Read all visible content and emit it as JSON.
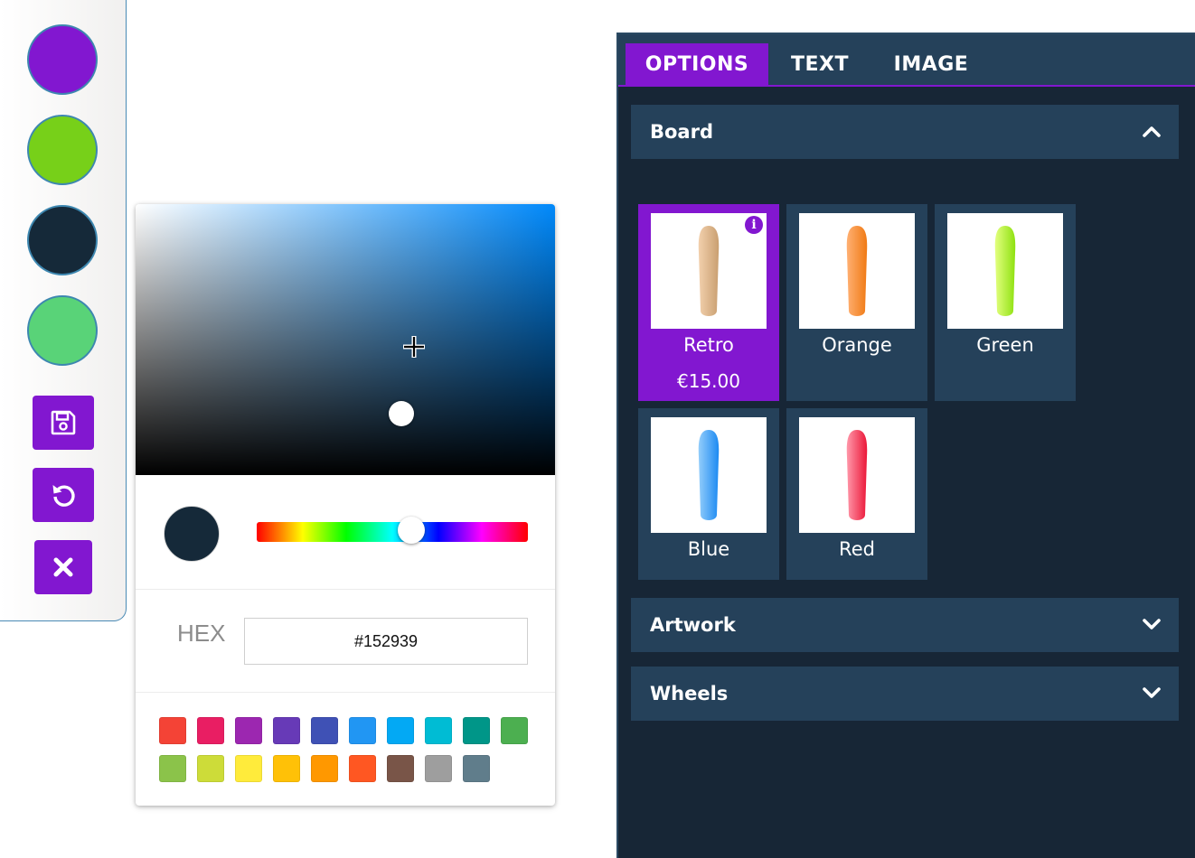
{
  "toolbar": {
    "color_swatches": [
      {
        "name": "purple",
        "color": "#8217d0"
      },
      {
        "name": "green",
        "color": "#77d019"
      },
      {
        "name": "navy",
        "color": "#152939"
      },
      {
        "name": "light-green",
        "color": "#59d378"
      }
    ],
    "buttons": [
      {
        "name": "save",
        "icon": "floppy-disk-icon"
      },
      {
        "name": "undo",
        "icon": "undo-icon"
      },
      {
        "name": "close",
        "icon": "close-icon"
      }
    ]
  },
  "color_picker": {
    "current_color": "#152939",
    "hex_label": "HEX",
    "hex_value": "#152939",
    "presets_row1": [
      "#f44336",
      "#e91e63",
      "#9c27b0",
      "#673ab7",
      "#3f51b5",
      "#2196f3",
      "#03a9f4",
      "#00bcd4",
      "#009688",
      "#4caf50"
    ],
    "presets_row2": [
      "#8bc34a",
      "#cddc39",
      "#ffeb3b",
      "#ffc107",
      "#ff9800",
      "#ff5722",
      "#795548",
      "#9e9e9e",
      "#607d8b"
    ]
  },
  "panel": {
    "tabs": [
      {
        "label": "OPTIONS",
        "active": true
      },
      {
        "label": "TEXT",
        "active": false
      },
      {
        "label": "IMAGE",
        "active": false
      }
    ],
    "sections": {
      "board": {
        "title": "Board",
        "expanded": true
      },
      "artwork": {
        "title": "Artwork",
        "expanded": false
      },
      "wheels": {
        "title": "Wheels",
        "expanded": false
      }
    },
    "board_options": [
      {
        "name": "Retro",
        "price": "€15.00",
        "selected": true,
        "colors": [
          "#f2d0ad",
          "#c99f70"
        ]
      },
      {
        "name": "Orange",
        "price": "",
        "selected": false,
        "colors": [
          "#ffb073",
          "#f07a14"
        ]
      },
      {
        "name": "Green",
        "price": "",
        "selected": false,
        "colors": [
          "#e3ff80",
          "#8ee10f"
        ]
      },
      {
        "name": "Blue",
        "price": "",
        "selected": false,
        "colors": [
          "#93cdfb",
          "#1c8af2"
        ]
      },
      {
        "name": "Red",
        "price": "",
        "selected": false,
        "colors": [
          "#ff98aa",
          "#eb1738"
        ]
      }
    ]
  }
}
